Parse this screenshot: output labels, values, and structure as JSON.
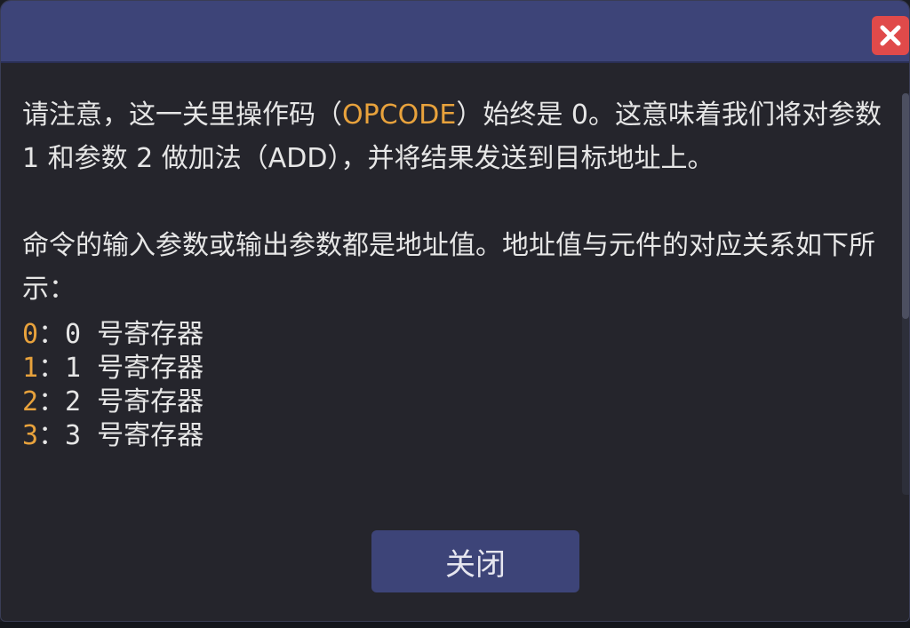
{
  "dialog": {
    "close_icon": "close-icon",
    "close_color": "#e04a4a",
    "accent_color": "#e8a23c",
    "titlebar_color": "#3d4478"
  },
  "content": {
    "p1": {
      "a": "请注意，这一关里操作码（",
      "b": "OPCODE",
      "c": "）始终是 0。这意味着我们将对参数 1 和参数 2 做加法（ADD），并将结果发送到目标地址上。"
    },
    "p2": "命令的输入参数或输出参数都是地址值。地址值与元件的对应关系如下所示：",
    "registers": [
      {
        "index": "0",
        "label": "：0 号寄存器"
      },
      {
        "index": "1",
        "label": "：1 号寄存器"
      },
      {
        "index": "2",
        "label": "：2 号寄存器"
      },
      {
        "index": "3",
        "label": "：3 号寄存器"
      }
    ]
  },
  "footer": {
    "close_label": "关闭"
  }
}
